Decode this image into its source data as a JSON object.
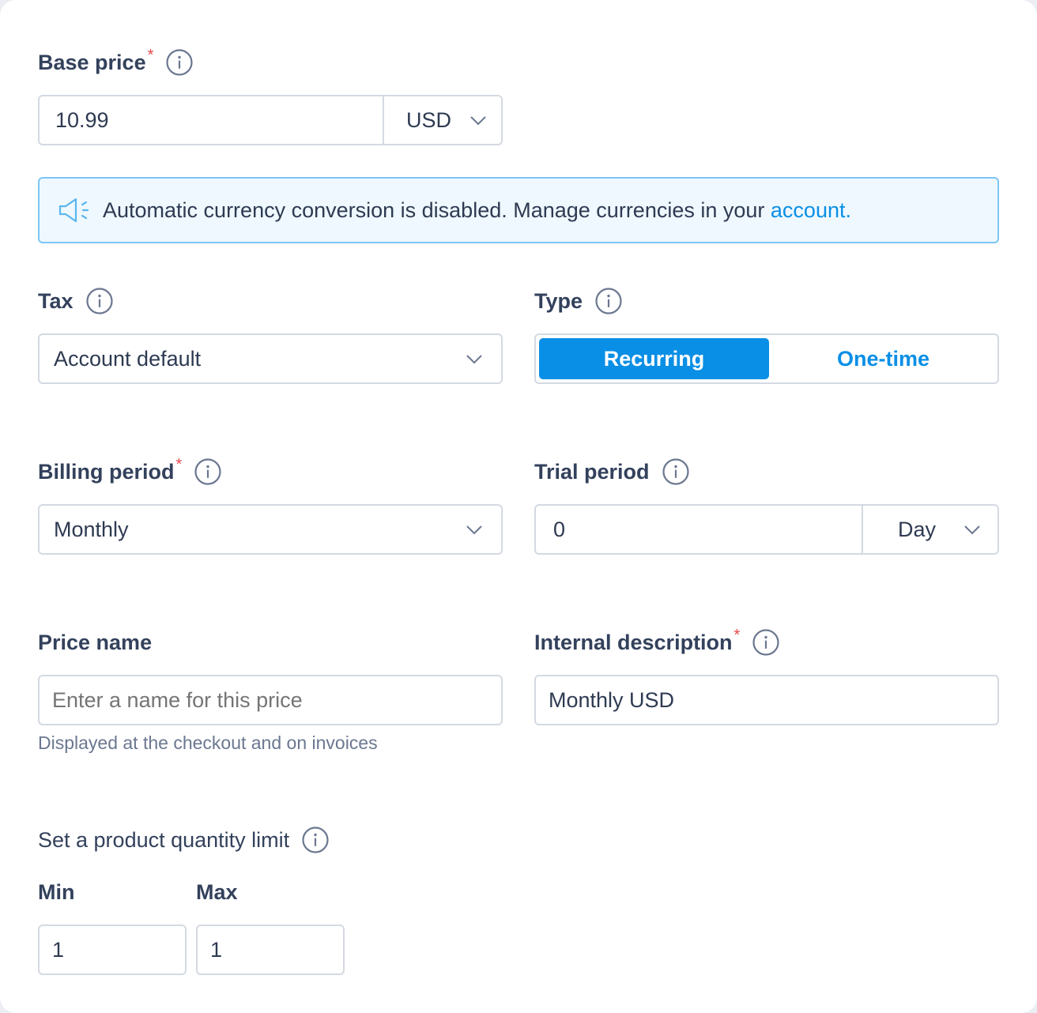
{
  "base_price": {
    "label": "Base price",
    "required_mark": "*",
    "value": "10.99",
    "currency": "USD"
  },
  "alert": {
    "message": "Automatic currency conversion is disabled. Manage currencies in your ",
    "link_text": "account."
  },
  "tax": {
    "label": "Tax",
    "selected": "Account default"
  },
  "type": {
    "label": "Type",
    "options": [
      "Recurring",
      "One-time"
    ],
    "selected": "Recurring"
  },
  "billing_period": {
    "label": "Billing period",
    "required_mark": "*",
    "selected": "Monthly"
  },
  "trial_period": {
    "label": "Trial period",
    "value": "0",
    "unit": "Day"
  },
  "price_name": {
    "label": "Price name",
    "placeholder": "Enter a name for this price",
    "value": "",
    "helper": "Displayed at the checkout and on invoices"
  },
  "internal_description": {
    "label": "Internal description",
    "required_mark": "*",
    "value": "Monthly USD"
  },
  "quantity_limit": {
    "label": "Set a product quantity limit",
    "min_label": "Min",
    "max_label": "Max",
    "min_value": "1",
    "max_value": "1"
  },
  "colors": {
    "accent": "#0a8fe6",
    "required": "#e5484d",
    "border": "#d4d9e2",
    "alert_border": "#7cc6f5",
    "alert_bg": "#eef8fe"
  },
  "icons": {
    "info": "info-circle-icon",
    "chevron": "chevron-down-icon",
    "alert": "megaphone-icon"
  }
}
